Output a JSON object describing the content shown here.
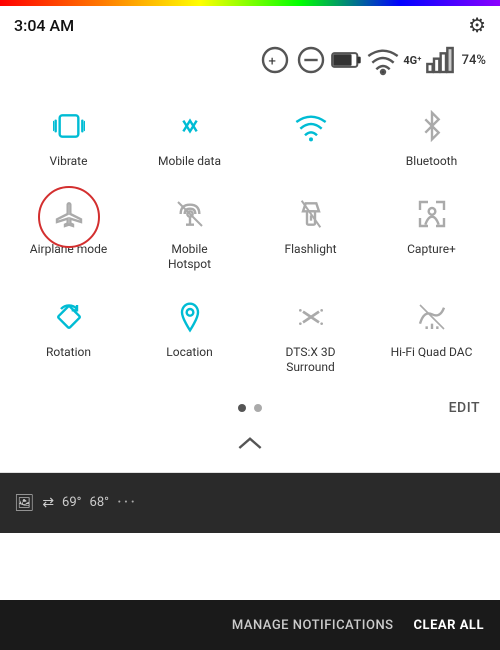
{
  "topBar": {
    "rainbow": true
  },
  "statusBar": {
    "time": "3:04 AM",
    "gearIcon": "⚙",
    "batteryPercent": "74%",
    "batteryIcon": "🔋",
    "signal": "4G⁺",
    "signalBars": "▮▮▮"
  },
  "quickSettings": {
    "tiles": [
      {
        "id": "vibrate",
        "label": "Vibrate",
        "active": true,
        "icon": "vibrate"
      },
      {
        "id": "mobile-data",
        "label": "Mobile data",
        "active": true,
        "icon": "mobile-data"
      },
      {
        "id": "wifi",
        "label": "",
        "active": true,
        "icon": "wifi"
      },
      {
        "id": "bluetooth",
        "label": "Bluetooth",
        "active": false,
        "icon": "bluetooth"
      },
      {
        "id": "airplane-mode",
        "label": "Airplane mode",
        "active": false,
        "icon": "airplane",
        "circled": true
      },
      {
        "id": "mobile-hotspot",
        "label": "Mobile\nHotspot",
        "active": false,
        "icon": "hotspot"
      },
      {
        "id": "flashlight",
        "label": "Flashlight",
        "active": false,
        "icon": "flashlight"
      },
      {
        "id": "capture-plus",
        "label": "Capture+",
        "active": false,
        "icon": "capture"
      },
      {
        "id": "rotation",
        "label": "Rotation",
        "active": true,
        "icon": "rotation"
      },
      {
        "id": "location",
        "label": "Location",
        "active": true,
        "icon": "location"
      },
      {
        "id": "dts-surround",
        "label": "DTS:X 3D\nSurround",
        "active": false,
        "icon": "dts"
      },
      {
        "id": "hifi-dac",
        "label": "Hi-Fi Quad DAC",
        "active": false,
        "icon": "hifi"
      }
    ]
  },
  "pagination": {
    "dots": [
      {
        "active": true
      },
      {
        "active": false
      }
    ],
    "editLabel": "EDIT"
  },
  "expandIcon": "∧",
  "notification": {
    "photo_icon": "🖼",
    "arrows_icon": "⇄",
    "temp": "69°",
    "temp2": "68°",
    "dots": "···"
  },
  "bottomBar": {
    "manageLabel": "MANAGE NOTIFICATIONS",
    "clearLabel": "CLEAR ALL"
  }
}
